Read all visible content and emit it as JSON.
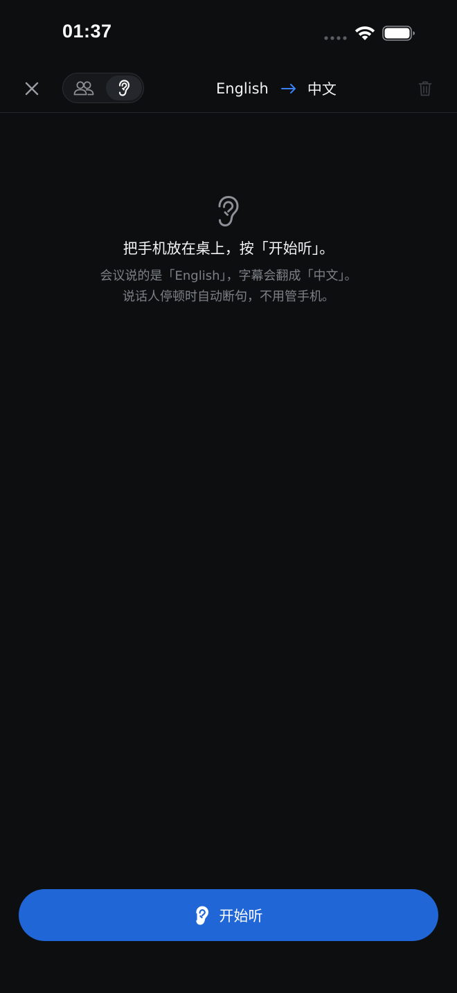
{
  "status_bar": {
    "time": "01:37",
    "signal_icon": "signal-bars-icon",
    "wifi_icon": "wifi-icon",
    "battery_icon": "battery-icon"
  },
  "nav": {
    "close_icon": "close-icon",
    "modes": [
      {
        "name": "conversation",
        "icon": "people-icon",
        "selected": false
      },
      {
        "name": "listen",
        "icon": "ear-icon",
        "selected": true
      }
    ],
    "source_language": "English",
    "target_language": "中文",
    "arrow_icon": "arrow-right-icon",
    "trash_icon": "trash-icon"
  },
  "empty_state": {
    "icon": "ear-icon",
    "title": "把手机放在桌上，按「开始听」。",
    "description_line1": "会议说的是「English」，字幕会翻成「中文」。",
    "description_line2": "说话人停顿时自动断句，不用管手机。"
  },
  "start_button": {
    "label": "开始听",
    "icon": "ear-icon"
  },
  "colors": {
    "background": "#0d0e10",
    "accent": "#2066d6",
    "arrow": "#3b82f6",
    "secondary_text": "#7c8087"
  }
}
